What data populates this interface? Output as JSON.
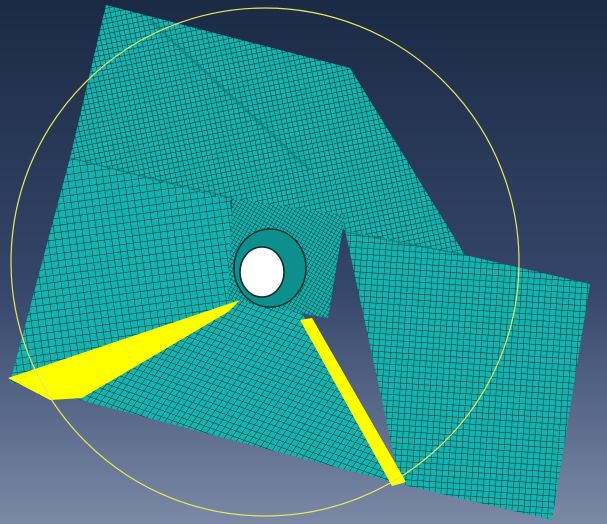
{
  "viewport": {
    "background_top": "#1b2a44",
    "background_bottom": "#7b89a6"
  },
  "mesh": {
    "face_color": "#13b3b0",
    "edge_color": "#052a2a",
    "rim_color": "#0c8f8d",
    "hole_fill": "#ffffff"
  },
  "selection": {
    "highlight_color": "#ffff00",
    "circle_color": "#e8e85a"
  }
}
